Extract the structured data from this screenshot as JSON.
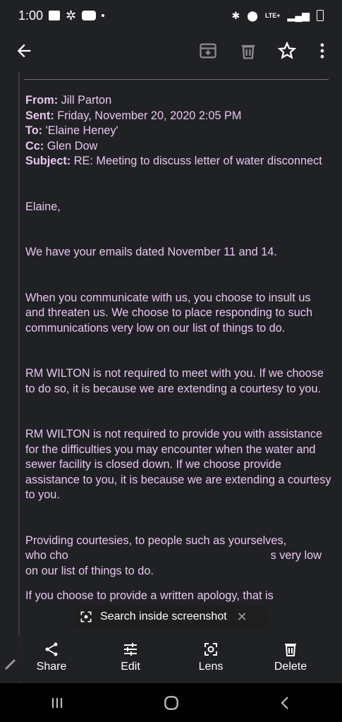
{
  "status_bar": {
    "time": "1:00",
    "network": "LTE+"
  },
  "email": {
    "header": {
      "from_label": "From:",
      "from_value": "Jill Parton",
      "sent_label": "Sent:",
      "sent_value": "Friday, November 20, 2020 2:05 PM",
      "to_label": "To:",
      "to_value": "'Elaine Heney'",
      "cc_label": "Cc:",
      "cc_value": "Glen Dow",
      "subject_label": "Subject:",
      "subject_value": "RE: Meeting to discuss letter of water disconnect"
    },
    "greeting": "Elaine,",
    "paragraphs": [
      "We have your emails dated November 11 and 14.",
      "When you communicate with us, you choose to insult us and threaten us.  We choose to place responding to such communications very low on our list of things to do.",
      "RM WILTON is not required to meet with you.  If we choose to do so, it is because we are extending a courtesy to you.",
      "RM WILTON is not required to provide you with assistance for the difficulties you may encounter when the water and sewer facility is closed down.  If we choose provide assistance to you, it is because we are extending a courtesy to you."
    ],
    "partial_line_1": "Providing courtesies, to people such as yourselves,",
    "partial_line_2a": "who cho",
    "partial_line_2b": "s very low",
    "partial_line_3": "on our list of things to do.",
    "partial_line_4": "If you choose to provide a written apology, that is"
  },
  "screenshot_toolbar": {
    "search_label": "Search inside screenshot",
    "actions": [
      {
        "label": "Share",
        "icon": "share-icon"
      },
      {
        "label": "Edit",
        "icon": "sliders-icon"
      },
      {
        "label": "Lens",
        "icon": "lens-icon"
      },
      {
        "label": "Delete",
        "icon": "trash-icon"
      }
    ]
  },
  "app_bar_icons": [
    "back-arrow-icon",
    "archive-icon",
    "delete-icon",
    "star-icon",
    "more-vert-icon"
  ]
}
